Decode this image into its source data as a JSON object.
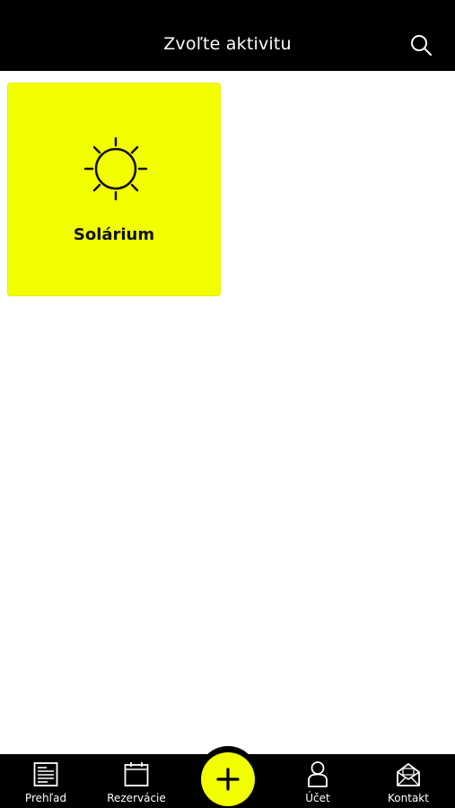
{
  "header": {
    "title": "Zvoľte aktivitu",
    "search_icon": "search-icon"
  },
  "activities": [
    {
      "label": "Solárium",
      "icon": "sun-icon",
      "color": "#f2ff00"
    }
  ],
  "bottom_nav": {
    "items": [
      {
        "label": "Prehľad",
        "icon": "list-icon"
      },
      {
        "label": "Rezervácie",
        "icon": "calendar-icon"
      },
      {
        "label": "Účet",
        "icon": "user-icon"
      },
      {
        "label": "Kontakt",
        "icon": "envelope-icon"
      }
    ],
    "fab_icon": "plus-icon",
    "accent": "#f2ff00"
  }
}
